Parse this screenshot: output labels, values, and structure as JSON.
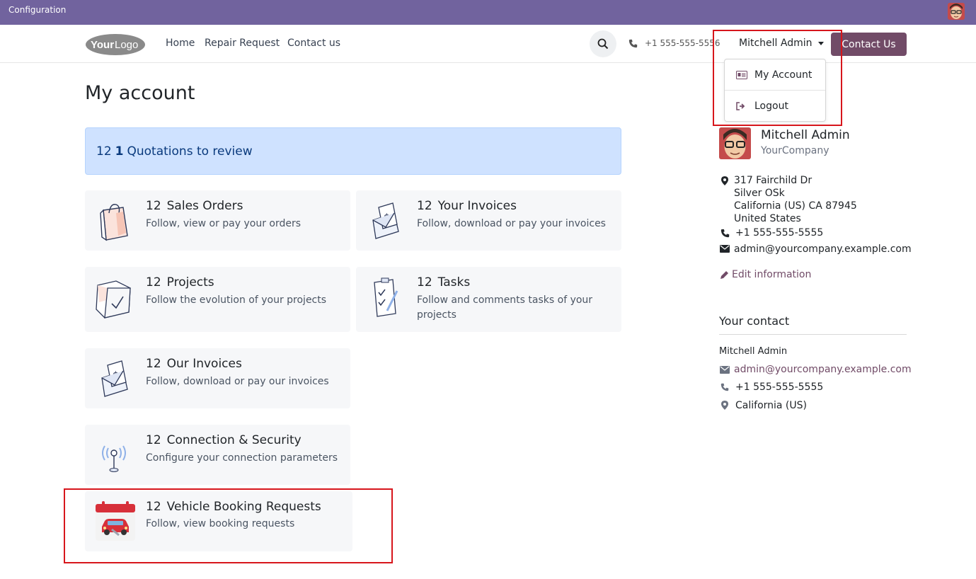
{
  "topbar": {
    "label": "Configuration"
  },
  "header": {
    "logo": {
      "part1": "Your",
      "part2": "Logo"
    },
    "nav": [
      "Home",
      "Repair Request",
      "Contact us"
    ],
    "phone": "+1 555-555-5556",
    "user": "Mitchell Admin",
    "contact_button": "Contact Us"
  },
  "dropdown": {
    "items": [
      "My Account",
      "Logout"
    ]
  },
  "page": {
    "title": "My account",
    "alert": {
      "count": "12",
      "bold": "1",
      "text": "Quotations to review"
    },
    "cards": [
      {
        "count": "12",
        "title": "Sales Orders",
        "desc": "Follow, view or pay your orders",
        "icon": "shopping-bag-icon"
      },
      {
        "count": "12",
        "title": "Your Invoices",
        "desc": "Follow, download or pay your invoices",
        "icon": "invoice-envelope-icon"
      },
      {
        "count": "12",
        "title": "Projects",
        "desc": "Follow the evolution of your projects",
        "icon": "folder-check-icon"
      },
      {
        "count": "12",
        "title": "Tasks",
        "desc": "Follow and comments tasks of your projects",
        "icon": "clipboard-tasks-icon"
      },
      {
        "count": "12",
        "title": "Our Invoices",
        "desc": "Follow, download or pay our invoices",
        "icon": "invoice-envelope-icon"
      },
      {
        "count": "12",
        "title": "Connection & Security",
        "desc": "Configure your connection parameters",
        "icon": "antenna-icon"
      },
      {
        "count": "12",
        "title": "Vehicle Booking Requests",
        "desc": "Follow, view booking requests",
        "icon": "car-calendar-icon"
      }
    ]
  },
  "profile": {
    "name": "Mitchell Admin",
    "company": "YourCompany",
    "address": [
      "317 Fairchild Dr",
      "Silver OSk",
      "California (US) CA 87945",
      "United States"
    ],
    "phone": "+1 555-555-5555",
    "email": "admin@yourcompany.example.com",
    "edit": "Edit information"
  },
  "your_contact": {
    "heading": "Your contact",
    "name": "Mitchell Admin",
    "email": "admin@yourcompany.example.com",
    "phone": "+1 555-555-5555",
    "location": "California (US)"
  },
  "colors": {
    "topbar": "#71639e",
    "brand": "#714b67",
    "alert_bg": "#cfe2ff",
    "highlight": "#d7161c"
  }
}
